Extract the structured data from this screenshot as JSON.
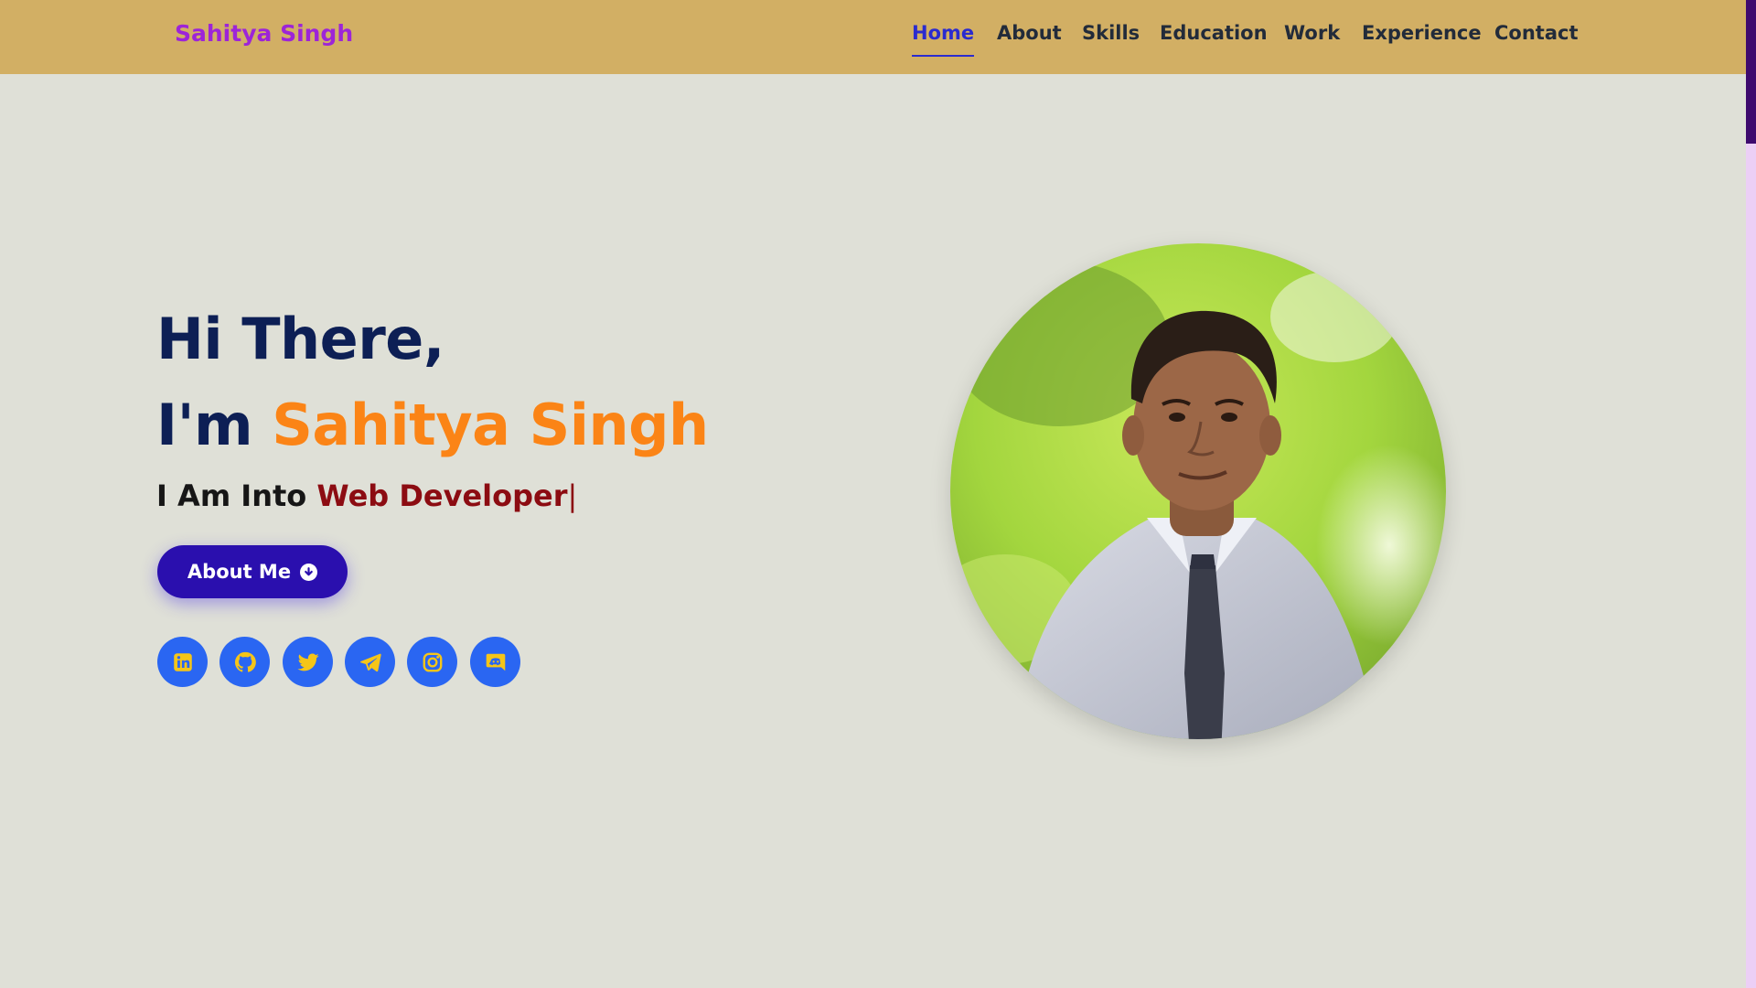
{
  "navbar": {
    "brand": "Sahitya Singh",
    "links": [
      {
        "label": "Home",
        "active": true
      },
      {
        "label": "About",
        "active": false
      },
      {
        "label": "Skills",
        "active": false
      },
      {
        "label": "Education",
        "active": false
      },
      {
        "label": "Work",
        "active": false
      },
      {
        "label": "Experience",
        "active": false
      },
      {
        "label": "Contact",
        "active": false
      }
    ]
  },
  "hero": {
    "greeting": "Hi There,",
    "intro": "I'm",
    "name": "Sahitya Singh",
    "tagline_prefix": "I Am Into",
    "role": "Web Developer",
    "cursor": "|",
    "button_label": "About Me",
    "button_icon": "arrow-circle-down-icon",
    "socials": [
      {
        "name": "linkedin",
        "icon": "linkedin-icon"
      },
      {
        "name": "github",
        "icon": "github-icon"
      },
      {
        "name": "twitter",
        "icon": "twitter-icon"
      },
      {
        "name": "telegram",
        "icon": "telegram-icon"
      },
      {
        "name": "instagram",
        "icon": "instagram-icon"
      },
      {
        "name": "discord",
        "icon": "discord-icon"
      }
    ]
  },
  "colors": {
    "navbar_bg": "#d2af64",
    "brand": "#9d24d8",
    "page_bg": "#dfe0d7",
    "heading": "#0d1f55",
    "name_accent": "#fb8416",
    "role_accent": "#8c0c12",
    "button_bg": "#2a0fae",
    "social_bg": "#2a66f2",
    "social_icon": "#f5c518",
    "active_link": "#2b2bcf"
  }
}
